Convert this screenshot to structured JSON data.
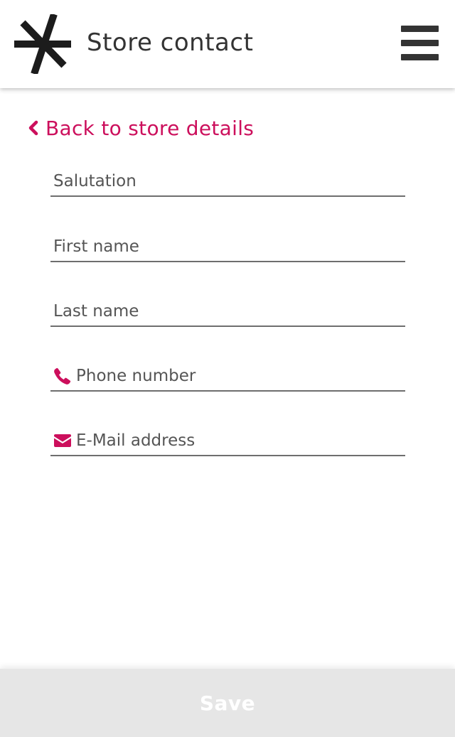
{
  "header": {
    "title": "Store contact",
    "logo_icon": "asterisk-logo-icon",
    "menu_icon": "hamburger-menu-icon"
  },
  "back_link": {
    "label": "Back to store details",
    "icon": "chevron-left-icon"
  },
  "form": {
    "salutation": {
      "placeholder": "Salutation",
      "value": ""
    },
    "first_name": {
      "placeholder": "First name",
      "value": ""
    },
    "last_name": {
      "placeholder": "Last name",
      "value": ""
    },
    "phone": {
      "placeholder": "Phone number",
      "value": "",
      "icon": "phone-icon"
    },
    "email": {
      "placeholder": "E-Mail address",
      "value": "",
      "icon": "envelope-icon"
    }
  },
  "footer": {
    "save_label": "Save",
    "save_enabled": false
  },
  "colors": {
    "accent": "#cc0f5c",
    "text": "#333333",
    "save_bar_bg": "#e6e6e6"
  }
}
